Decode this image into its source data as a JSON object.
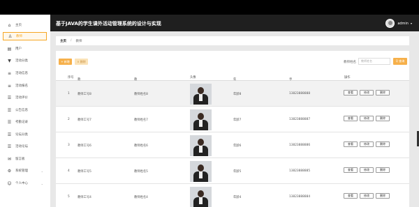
{
  "header": {
    "title": "基于JAVA的学生课外活动管理系统的设计与实现",
    "user": "admin"
  },
  "sidebar": {
    "items": [
      {
        "label": "主页",
        "icon": "home-icon",
        "glyph": "⌂"
      },
      {
        "label": "教师",
        "icon": "user-icon",
        "glyph": "♙"
      },
      {
        "label": "用户",
        "icon": "users-icon",
        "glyph": "▤"
      },
      {
        "label": "活动分类",
        "icon": "category-icon",
        "glyph": "▼"
      },
      {
        "label": "活动信息",
        "icon": "info-icon",
        "glyph": "≡"
      },
      {
        "label": "活动报名",
        "icon": "signup-icon",
        "glyph": "≡"
      },
      {
        "label": "活动评价",
        "icon": "rate-icon",
        "glyph": "☰"
      },
      {
        "label": "公告信息",
        "icon": "notice-icon",
        "glyph": "☰"
      },
      {
        "label": "考勤记录",
        "icon": "attendance-icon",
        "glyph": "☰"
      },
      {
        "label": "论坛分类",
        "icon": "forum-category-icon",
        "glyph": "☰"
      },
      {
        "label": "活动论坛",
        "icon": "forum-icon",
        "glyph": "☰"
      },
      {
        "label": "留言板",
        "icon": "message-icon",
        "glyph": "✉"
      },
      {
        "label": "系统管理",
        "icon": "settings-icon",
        "glyph": "⚙"
      },
      {
        "label": "个人中心",
        "icon": "person-icon",
        "glyph": "☺"
      }
    ]
  },
  "breadcrumb": {
    "home": "主页",
    "current": "教师"
  },
  "toolbar": {
    "add": "+ 新增",
    "delete": "× 删除",
    "search_label": "教师姓名",
    "search_placeholder": "教师姓名",
    "search_button": "Q 查询"
  },
  "table": {
    "columns": [
      "序号",
      "教师工号",
      "教师姓名",
      "头像",
      "年龄",
      "手机",
      "操作"
    ],
    "rows": [
      {
        "no": "1",
        "id": "教师工号8",
        "name": "教师姓名8",
        "age": "年龄8",
        "phone": "13823888888"
      },
      {
        "no": "2",
        "id": "教师工号7",
        "name": "教师姓名7",
        "age": "年龄7",
        "phone": "13823888887"
      },
      {
        "no": "3",
        "id": "教师工号6",
        "name": "教师姓名6",
        "age": "年龄6",
        "phone": "13823888886"
      },
      {
        "no": "4",
        "id": "教师工号5",
        "name": "教师姓名5",
        "age": "年龄5",
        "phone": "13823888885"
      },
      {
        "no": "5",
        "id": "教师工号4",
        "name": "教师姓名4",
        "age": "年龄4",
        "phone": "13823888884"
      }
    ],
    "actions": {
      "view": "查看",
      "edit": "修改",
      "delete": "删除"
    }
  },
  "colors": {
    "accent": "#f6b04a",
    "header_bg": "#1f1f1f"
  }
}
